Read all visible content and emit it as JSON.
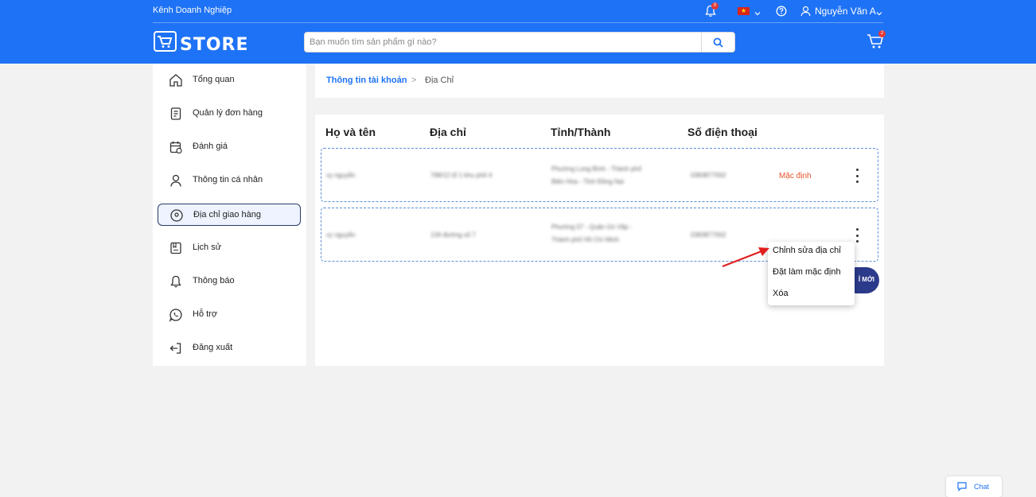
{
  "header": {
    "business_channel": "Kênh Doanh Nghiệp",
    "notification_count": "0",
    "language_flag": "vn-flag",
    "user_name": "Nguyễn Văn A",
    "logo_text": "STORE",
    "search_placeholder": "Bạn muốn tìm sản phẩm gì nào?",
    "cart_count": "2",
    "accent_color": "#1e72f5"
  },
  "sidebar": {
    "items": [
      {
        "label": "Tổng quan",
        "icon": "home-icon"
      },
      {
        "label": "Quản lý đơn hàng",
        "icon": "receipt-icon"
      },
      {
        "label": "Đánh giá",
        "icon": "calendar-review-icon"
      },
      {
        "label": "Thông tin cá nhân",
        "icon": "user-icon"
      },
      {
        "label": "Địa chỉ giao hàng",
        "icon": "location-pin-icon",
        "active": true
      },
      {
        "label": "Lịch sử",
        "icon": "history-icon"
      },
      {
        "label": "Thông báo",
        "icon": "bell-icon"
      },
      {
        "label": "Hỗ trợ",
        "icon": "whatsapp-icon"
      },
      {
        "label": "Đăng xuất",
        "icon": "logout-icon"
      }
    ]
  },
  "breadcrumb": {
    "parent": "Thông tin tài khoản",
    "separator": ">",
    "current": "Địa Chỉ"
  },
  "table": {
    "headers": [
      "Họ và tên",
      "Địa chỉ",
      "Tỉnh/Thành",
      "Số điện thoại"
    ],
    "rows": [
      {
        "name": "vy nguyễn",
        "address": "798/12 tổ 1 khu phố 4",
        "province_line1": "Phường Long Bình - Thành phố",
        "province_line2": "Biên Hòa - Tỉnh Đồng Nai",
        "phone": "0383877002",
        "tag": "Mặc định"
      },
      {
        "name": "vy nguyễn",
        "address": "134 đường số 7",
        "province_line1": "Phường 07 - Quận Gò Vấp -",
        "province_line2": "Thành phố Hồ Chí Minh",
        "phone": "0383877002",
        "tag": ""
      }
    ]
  },
  "add_button": {
    "label_fragment": "Ỉ MỚI"
  },
  "context_menu": {
    "items": [
      "Chỉnh sửa địa chỉ",
      "Đặt làm mặc định",
      "Xóa"
    ]
  },
  "chat": {
    "label": "Chat"
  }
}
